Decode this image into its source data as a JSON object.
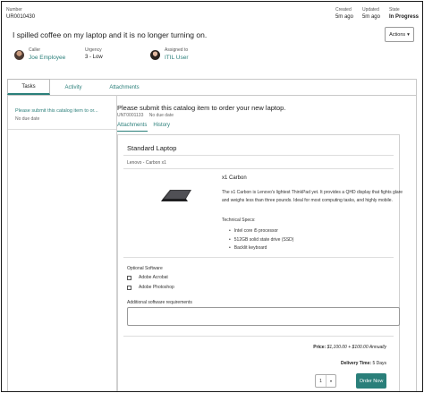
{
  "record": {
    "number_label": "Number",
    "number_value": "UR0010430",
    "meta": [
      {
        "label": "Created",
        "value": "5m ago"
      },
      {
        "label": "Updated",
        "value": "5m ago"
      },
      {
        "label": "State",
        "value": "In Progress"
      }
    ],
    "title": "I spilled coffee on my laptop and it is no longer turning on.",
    "actions_label": "Actions",
    "caller_label": "Caller",
    "caller_name": "Joe Employee",
    "urgency_label": "Urgency",
    "urgency_value": "3 - Low",
    "assigned_label": "Assigned to",
    "assigned_name": "ITIL User"
  },
  "tabs": [
    {
      "label": "Tasks",
      "active": true
    },
    {
      "label": "Activity",
      "active": false
    },
    {
      "label": "Attachments",
      "active": false
    }
  ],
  "task_list": [
    {
      "title": "Please submit this catalog item to or...",
      "due": "No due date"
    }
  ],
  "task_detail": {
    "title": "Please submit this catalog item to order your new laptop.",
    "number": "UNT0001133",
    "due": "No due date",
    "subtabs": [
      "Attachments",
      "History"
    ]
  },
  "catalog_item": {
    "name": "Standard Laptop",
    "subtitle": "Lenovo - Carbon x1",
    "product_name": "x1 Carbon",
    "description": "The x1 Carbon is Lenovo's lightest ThinkPad yet. It provides a QHD display that fights glare and weighs less than three pounds. Ideal for most computing tasks, and highly mobile.",
    "specs_heading": "Technical Specs:",
    "specs": [
      "Intel core i5 processor",
      "512GB solid state drive (SSD)",
      "Backlit keyboard"
    ],
    "optional_heading": "Optional Software",
    "options": [
      "Adobe Acrobat",
      "Adobe Photoshop"
    ],
    "requirements_label": "Additional software requirements",
    "price_label": "Price:",
    "price_value": "$1,100.00 + $100.00 Annually",
    "delivery_label": "Delivery Time:",
    "delivery_value": "5 Days",
    "quantity": "1",
    "order_label": "Order Now"
  },
  "colors": {
    "accent": "#2a7f7a"
  }
}
